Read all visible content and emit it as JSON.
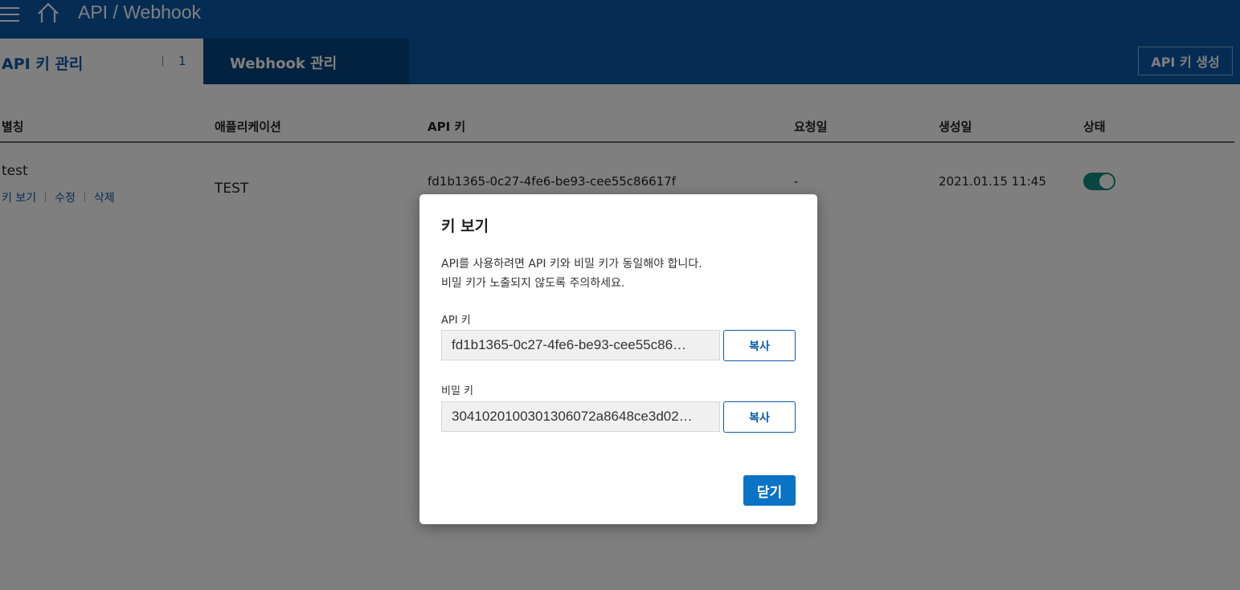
{
  "header": {
    "title": "API / Webhook",
    "menu_icon": "hamburger-menu-icon",
    "home_icon": "home-icon"
  },
  "tabs": {
    "api_keys": {
      "label": "API 키 관리",
      "count": "1"
    },
    "webhooks": {
      "label": "Webhook 관리"
    }
  },
  "toolbar": {
    "create_label": "API 키 생성"
  },
  "table": {
    "columns": [
      "별칭",
      "애플리케이션",
      "API 키",
      "요청일",
      "생성일",
      "상태"
    ],
    "rows": [
      {
        "alias": "test",
        "actions": [
          "키 보기",
          "수정",
          "삭제"
        ],
        "application": "TEST",
        "api_key": "fd1b1365-0c27-4fe6-be93-cee55c86617f",
        "requested": "-",
        "created": "2021.01.15 11:45",
        "status_on": true
      }
    ]
  },
  "dialog": {
    "title": "키 보기",
    "description": [
      "API를 사용하려면 API 키와 비밀 키가 동일해야 합니다.",
      "비밀 키가 노출되지 않도록 주의하세요."
    ],
    "api_key_label": "API 키",
    "api_key_value": "fd1b1365-0c27-4fe6-be93-cee55c86…",
    "secret_key_label": "비밀 키",
    "secret_key_value": "3041020100301306072a8648ce3d02…",
    "copy_label": "복사",
    "close_label": "닫기"
  },
  "colors": {
    "primary": "#0a5aa8",
    "tab_dark": "#07457f",
    "toggle_on": "#128c7e",
    "button_blue": "#0a73c6"
  }
}
